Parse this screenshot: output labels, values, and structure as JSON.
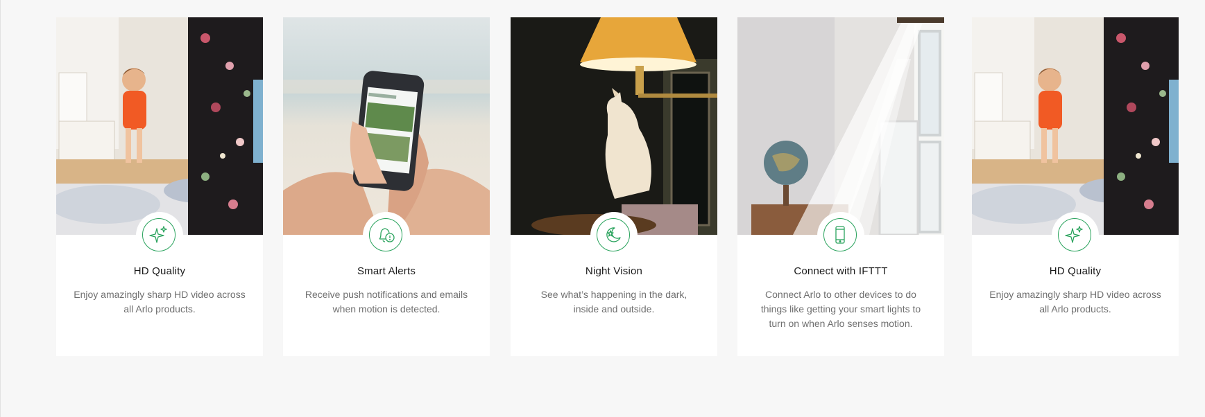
{
  "colors": {
    "accent": "#2aa35d",
    "background": "#f7f7f7",
    "card": "#ffffff",
    "title": "#1a1a1a",
    "body": "#6f6f6f"
  },
  "features": [
    {
      "title": "HD Quality",
      "description": "Enjoy amazingly sharp HD video across all Arlo products.",
      "icon": "sparkle-icon",
      "image": "child-in-bedroom-photo"
    },
    {
      "title": "Smart Alerts",
      "description": "Receive push notifications and emails when motion is detected.",
      "icon": "bell-alert-icon",
      "image": "phone-in-hands-photo"
    },
    {
      "title": "Night Vision",
      "description": "See what’s happening in the dark, inside and outside.",
      "icon": "moon-star-icon",
      "image": "cat-under-lamp-photo"
    },
    {
      "title": "Connect with IFTTT",
      "description": "Connect Arlo to other devices to do things like getting your smart lights to turn on when Arlo senses motion.",
      "icon": "smartphone-icon",
      "image": "curtain-window-photo"
    },
    {
      "title": "HD Quality",
      "description": "Enjoy amazingly sharp HD video across all Arlo products.",
      "icon": "sparkle-icon",
      "image": "child-in-bedroom-photo"
    }
  ]
}
